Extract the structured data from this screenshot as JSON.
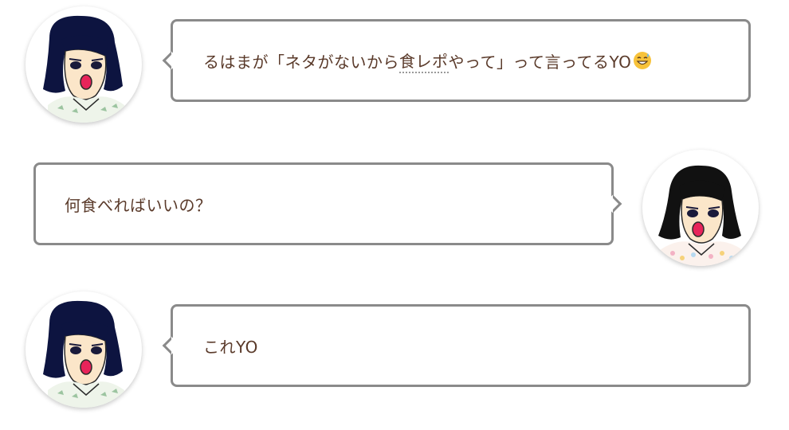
{
  "messages": [
    {
      "side": "left",
      "speaker_avatar": "avatar-short-hair-girl",
      "text_before": "るはまが「ネタがないから",
      "text_underlined": "食レポ",
      "text_after": "やって」って言ってるYO",
      "emoji": "grinning-sweat-emoji"
    },
    {
      "side": "right",
      "speaker_avatar": "avatar-long-hair-girl",
      "text": "何食べればいいの？"
    },
    {
      "side": "left",
      "speaker_avatar": "avatar-short-hair-girl",
      "text": "これYO"
    }
  ],
  "colors": {
    "text": "#5a3a2a",
    "bubble_border": "#8a8a8a",
    "hair": "#0d1440",
    "mouth": "#e8245a",
    "skin": "#fbe6c9"
  }
}
